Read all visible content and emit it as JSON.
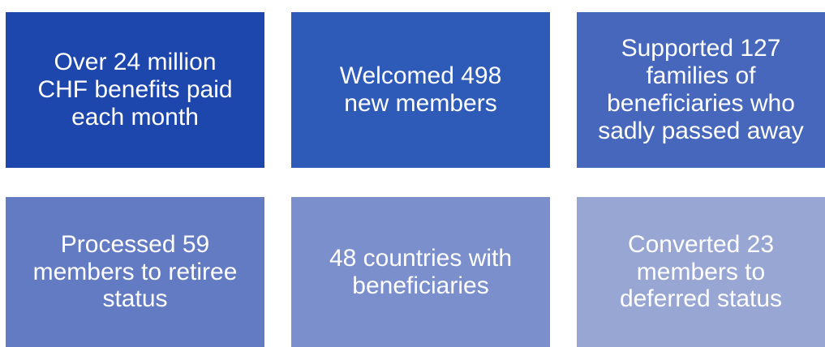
{
  "tiles": [
    {
      "text": "Over 24 million\nCHF benefits paid\neach month",
      "color": "#1d47ad"
    },
    {
      "text": "Welcomed 498\nnew members",
      "color": "#2f5bb8"
    },
    {
      "text": "Supported 127\nfamilies of\nbeneficiaries who\nsadly passed away",
      "color": "#4667bb"
    },
    {
      "text": "Processed 59\nmembers to retiree\nstatus",
      "color": "#637bc2"
    },
    {
      "text": "48 countries with\nbeneficiaries",
      "color": "#7a8fcb"
    },
    {
      "text": "Converted 23\nmembers to\ndeferred status",
      "color": "#98a6d4"
    }
  ]
}
